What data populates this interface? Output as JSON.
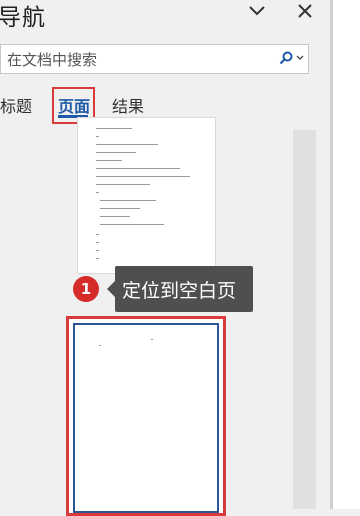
{
  "panel": {
    "title": "导航",
    "icons": {
      "collapse": "chevron-down-icon",
      "close": "close-icon",
      "search": "search-icon"
    }
  },
  "search": {
    "placeholder": "在文档中搜索"
  },
  "tabs": [
    {
      "label": "标题",
      "selected": false
    },
    {
      "label": "页面",
      "selected": true
    },
    {
      "label": "结果",
      "selected": false
    }
  ],
  "annotation": {
    "step": "1",
    "text": "定位到空白页"
  },
  "colors": {
    "accent": "#1f5aa8",
    "highlight": "#d93a3a",
    "callout_bg": "#4f4f4f",
    "page_border": "#2a5596"
  }
}
